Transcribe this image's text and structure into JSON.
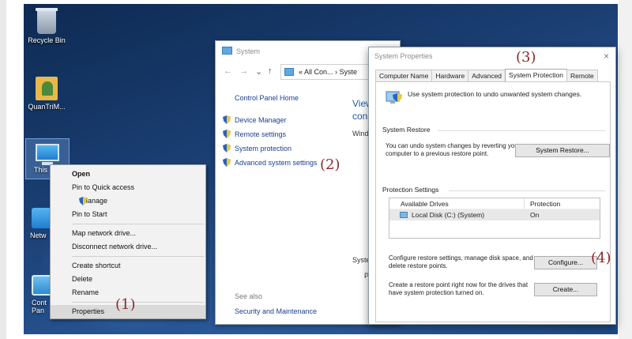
{
  "desktop": {
    "icons": [
      {
        "label": "Recycle Bin"
      },
      {
        "label": "QuanTriM..."
      },
      {
        "label": "This"
      },
      {
        "label": "Netw"
      },
      {
        "label": "Cont Pan"
      }
    ]
  },
  "context_menu": {
    "items": [
      {
        "label": "Open",
        "bold": true
      },
      {
        "label": "Pin to Quick access"
      },
      {
        "label": "Manage",
        "icon": "shield-icon"
      },
      {
        "label": "Pin to Start"
      },
      {
        "label": "Map network drive..."
      },
      {
        "label": "Disconnect network drive..."
      },
      {
        "label": "Create shortcut"
      },
      {
        "label": "Delete"
      },
      {
        "label": "Rename"
      },
      {
        "label": "Properties",
        "highlighted": true
      }
    ]
  },
  "system_window": {
    "title": "System",
    "address": "« All Con... › Syste",
    "right_peek": [
      "View",
      "con",
      "Wind",
      "Syste",
      "P"
    ],
    "home": "Control Panel Home",
    "links": [
      "Device Manager",
      "Remote settings",
      "System protection",
      "Advanced system settings"
    ],
    "see_also": "See also",
    "security": "Security and Maintenance"
  },
  "system_properties": {
    "title": "System Properties",
    "tabs": [
      "Computer Name",
      "Hardware",
      "Advanced",
      "System Protection",
      "Remote"
    ],
    "active_tab": "System Protection",
    "intro": "Use system protection to undo unwanted system changes.",
    "system_restore": {
      "heading": "System Restore",
      "text": "You can undo system changes by reverting your computer to a previous restore point.",
      "button": "System Restore..."
    },
    "protection_settings": {
      "heading": "Protection Settings",
      "col_drives": "Available Drives",
      "col_protection": "Protection",
      "drive": "Local Disk (C:) (System)",
      "protection": "On"
    },
    "configure": {
      "text": "Configure restore settings, manage disk space, and delete restore points.",
      "button": "Configure..."
    },
    "create": {
      "text": "Create a restore point right now for the drives that have system protection turned on.",
      "button": "Create..."
    },
    "close_glyph": "×"
  },
  "annotations": [
    "(1)",
    "(2)",
    "(3)",
    "(4)"
  ]
}
